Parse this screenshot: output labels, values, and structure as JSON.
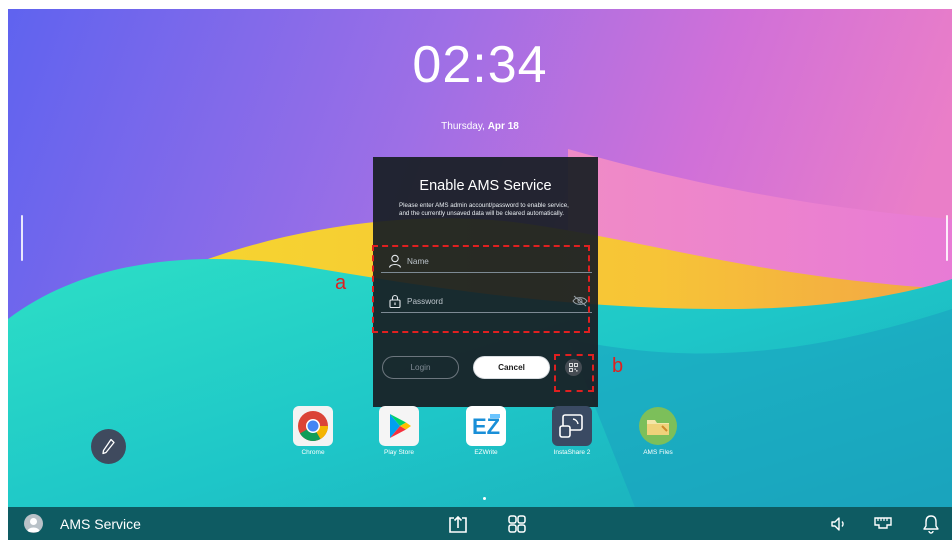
{
  "clock": {
    "time": "02:34",
    "weekday": "Thursday,",
    "date": "Apr 18"
  },
  "dialog": {
    "title": "Enable AMS Service",
    "description": "Please enter AMS admin account/password to enable service, and the currently unsaved data will be cleared automatically.",
    "name_placeholder": "Name",
    "password_placeholder": "Password",
    "login_label": "Login",
    "cancel_label": "Cancel"
  },
  "annotations": {
    "a": "a",
    "b": "b"
  },
  "apps": [
    {
      "label": "Chrome",
      "icon": "chrome-icon"
    },
    {
      "label": "Play Store",
      "icon": "play-store-icon"
    },
    {
      "label": "EZWrite",
      "icon": "ezwrite-icon"
    },
    {
      "label": "InstaShare 2",
      "icon": "instashare-icon"
    },
    {
      "label": "AMS Files",
      "icon": "ams-files-icon"
    }
  ],
  "taskbar": {
    "user": "AMS Service",
    "icons": [
      "user-avatar-icon",
      "screen-share-icon",
      "apps-grid-icon",
      "volume-icon",
      "network-icon",
      "notification-bell-icon"
    ]
  },
  "colors": {
    "annotation": "#e02020",
    "taskbar": "#0e5b62",
    "dialog": "#181e24"
  }
}
